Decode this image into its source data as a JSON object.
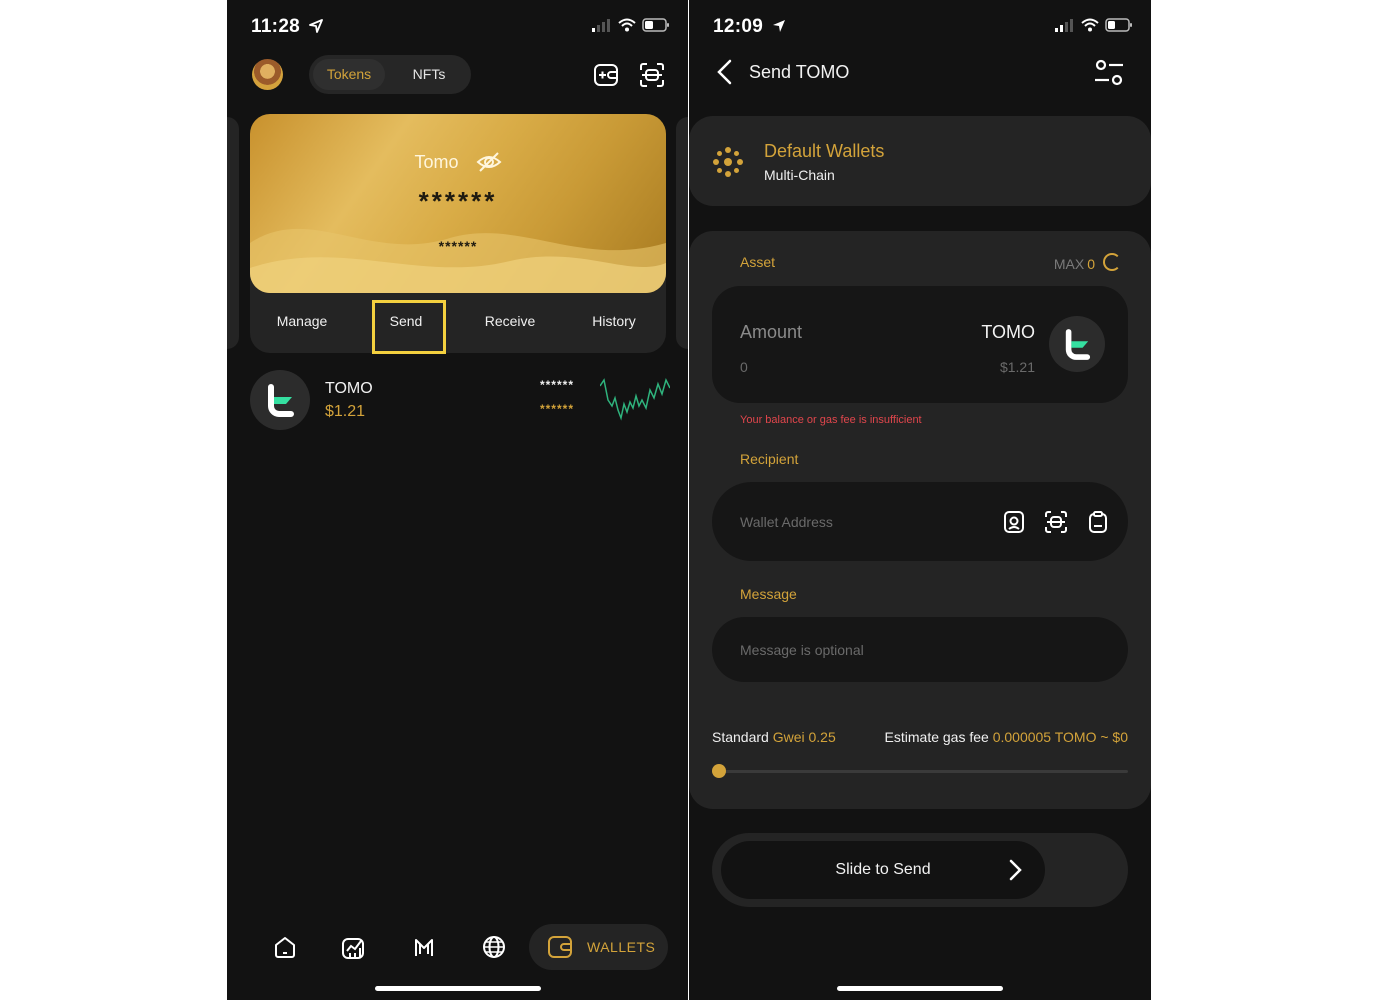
{
  "left": {
    "status": {
      "time": "11:28"
    },
    "tabs": {
      "tokens": "Tokens",
      "nfts": "NFTs"
    },
    "card": {
      "name": "Tomo",
      "balance": "******",
      "sub_balance": "******"
    },
    "actions": {
      "manage": "Manage",
      "send": "Send",
      "receive": "Receive",
      "history": "History"
    },
    "tokens": [
      {
        "symbol": "TOMO",
        "price": "$1.21",
        "amount_hidden": "******",
        "value_hidden": "******",
        "trend_color": "#2fb37d"
      }
    ],
    "nav": {
      "wallets": "WALLETS",
      "active_tab": "wallets"
    }
  },
  "right": {
    "status": {
      "time": "12:09"
    },
    "header": {
      "title": "Send TOMO"
    },
    "wallet": {
      "name": "Default Wallets",
      "chain": "Multi-Chain"
    },
    "asset": {
      "label": "Asset",
      "max_label": "MAX",
      "max_value": "0",
      "amount_label": "Amount",
      "amount_value": "0",
      "symbol": "TOMO",
      "usd_price": "$1.21"
    },
    "error": "Your balance or gas fee is insufficient",
    "recipient": {
      "label": "Recipient",
      "placeholder": "Wallet Address"
    },
    "message": {
      "label": "Message",
      "placeholder": "Message is optional"
    },
    "gas": {
      "speed_label": "Standard",
      "gwei_text": "Gwei 0.25",
      "fee_label": "Estimate gas fee",
      "fee_value": "0.000005 TOMO ~ $0",
      "slider_fraction": 0
    },
    "send_button": "Slide to Send"
  },
  "colors": {
    "accent": "#d3a33a",
    "error": "#e0464c",
    "background": "#121212",
    "panel": "#242424",
    "tomo_green": "#35e0a1"
  }
}
